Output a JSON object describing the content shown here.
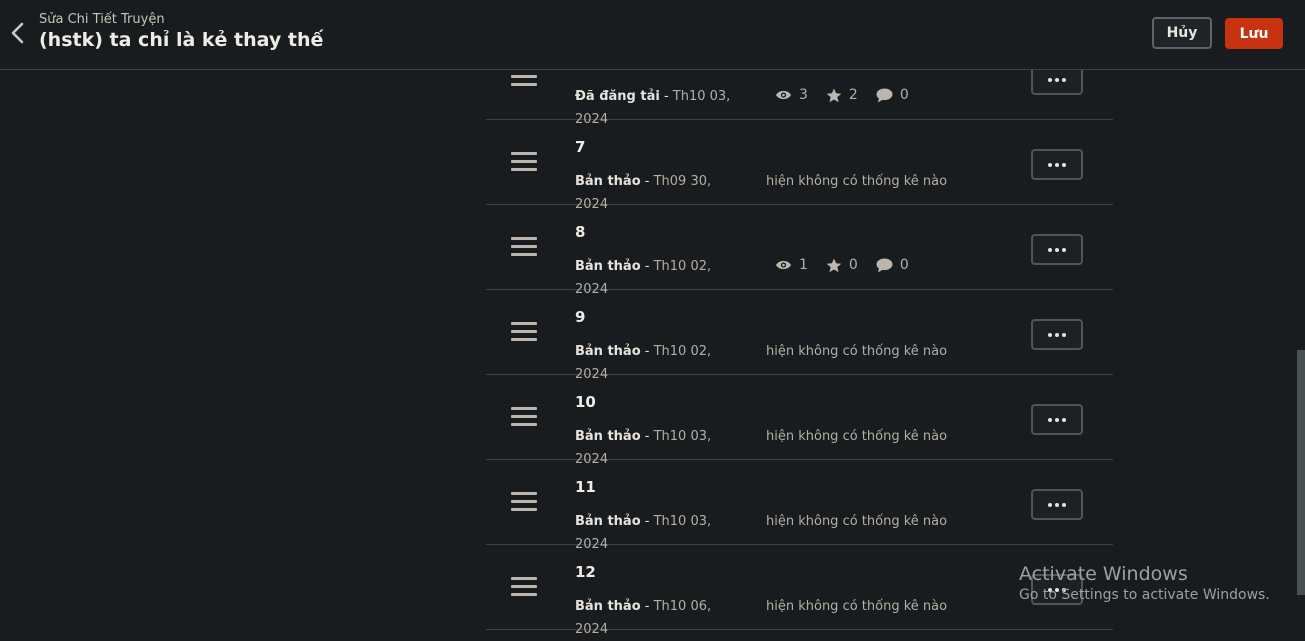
{
  "header": {
    "subtitle": "Sửa Chi Tiết Truyện",
    "title": "(hstk) ta chỉ là kẻ thay thế",
    "cancel_label": "Hủy",
    "save_label": "Lưu"
  },
  "parts": [
    {
      "number": "",
      "status": "Đã đăng tải",
      "date": "Th10 03, 2024",
      "stats": {
        "views": "3",
        "votes": "2",
        "comments": "0"
      },
      "no_stats_text": ""
    },
    {
      "number": "7",
      "status": "Bản thảo",
      "date": "Th09 30, 2024",
      "stats": null,
      "no_stats_text": "hiện không có thống kê nào"
    },
    {
      "number": "8",
      "status": "Bản thảo",
      "date": "Th10 02, 2024",
      "stats": {
        "views": "1",
        "votes": "0",
        "comments": "0"
      },
      "no_stats_text": ""
    },
    {
      "number": "9",
      "status": "Bản thảo",
      "date": "Th10 02, 2024",
      "stats": null,
      "no_stats_text": "hiện không có thống kê nào"
    },
    {
      "number": "10",
      "status": "Bản thảo",
      "date": "Th10 03, 2024",
      "stats": null,
      "no_stats_text": "hiện không có thống kê nào"
    },
    {
      "number": "11",
      "status": "Bản thảo",
      "date": "Th10 03, 2024",
      "stats": null,
      "no_stats_text": "hiện không có thống kê nào"
    },
    {
      "number": "12",
      "status": "Bản thảo",
      "date": "Th10 06, 2024",
      "stats": null,
      "no_stats_text": "hiện không có thống kê nào"
    }
  ],
  "watermark": {
    "title": "Activate Windows",
    "subtitle": "Go to Settings to activate Windows."
  },
  "colors": {
    "background": "#181c1e",
    "accent": "#c9320f",
    "divider": "#3c4144"
  }
}
